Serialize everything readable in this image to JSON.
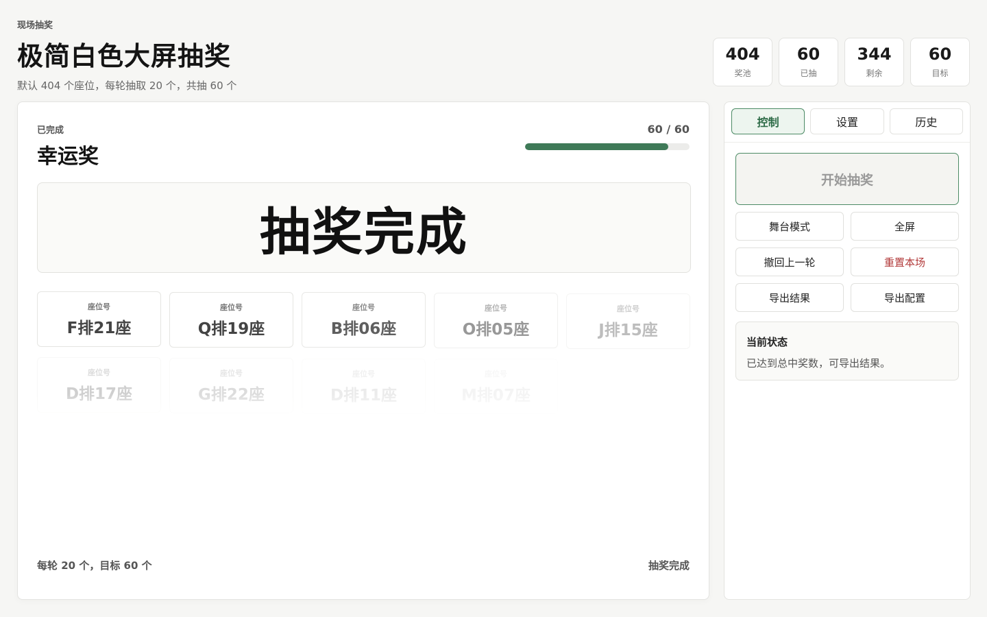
{
  "header": {
    "eyebrow": "现场抽奖",
    "title": "极简白色大屏抽奖",
    "subtitle": "默认 404 个座位，每轮抽取 20 个，共抽 60 个"
  },
  "stats": [
    {
      "value": "404",
      "label": "奖池"
    },
    {
      "value": "60",
      "label": "已抽"
    },
    {
      "value": "344",
      "label": "剩余"
    },
    {
      "value": "60",
      "label": "目标"
    }
  ],
  "stage": {
    "status": "已完成",
    "prize": "幸运奖",
    "progress_text": "60 / 60",
    "progress_fraction": 0.87,
    "result": "抽奖完成",
    "seat_label": "座位号",
    "seats": [
      "F排21座",
      "Q排19座",
      "B排06座",
      "O排05座",
      "J排15座",
      "D排17座",
      "G排22座",
      "D排11座",
      "M排07座"
    ],
    "footer_left": "每轮 20 个，目标 60 个",
    "footer_right": "抽奖完成"
  },
  "panel": {
    "tabs": [
      "控制",
      "设置",
      "历史"
    ],
    "active_tab": 0,
    "start_label": "开始抽奖",
    "controls": [
      "舞台模式",
      "全屏",
      "撤回上一轮",
      "重置本场",
      "导出结果",
      "导出配置"
    ],
    "status_title": "当前状态",
    "status_text": "已达到总中奖数，可导出结果。"
  },
  "colors": {
    "accent": "#3f7a58",
    "danger": "#b23a3a"
  }
}
